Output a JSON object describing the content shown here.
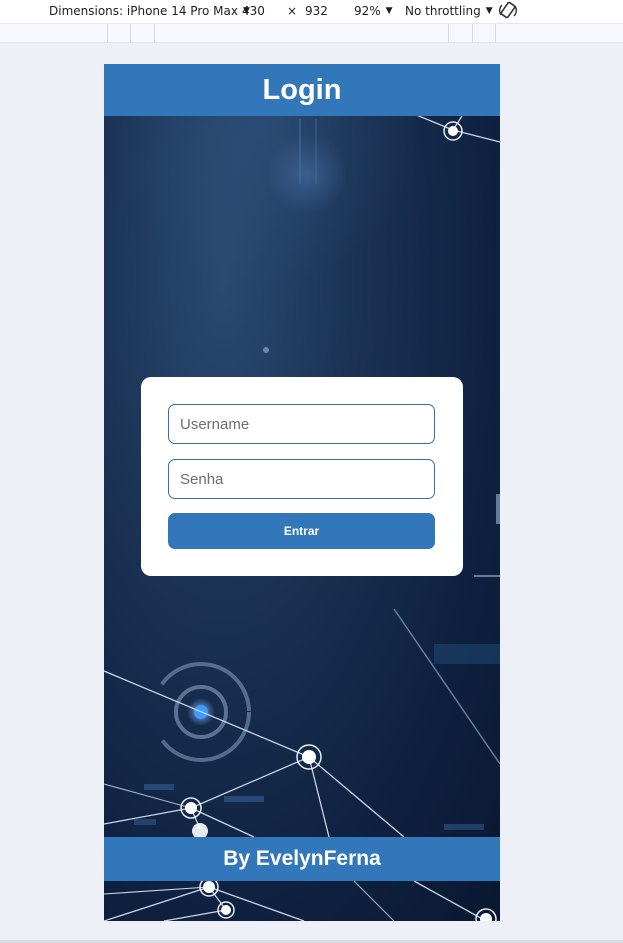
{
  "devtools": {
    "dimensions_label": "Dimensions: iPhone 14 Pro Max",
    "width": "430",
    "times": "×",
    "height": "932",
    "zoom": "92%",
    "throttling": "No throttling"
  },
  "page": {
    "title": "Login",
    "username_placeholder": "Username",
    "password_placeholder": "Senha",
    "submit_label": "Entrar",
    "footer_text": "By EvelynFerna"
  },
  "colors": {
    "primary": "#3277ba",
    "background": "#0f2140",
    "card": "#ffffff"
  }
}
